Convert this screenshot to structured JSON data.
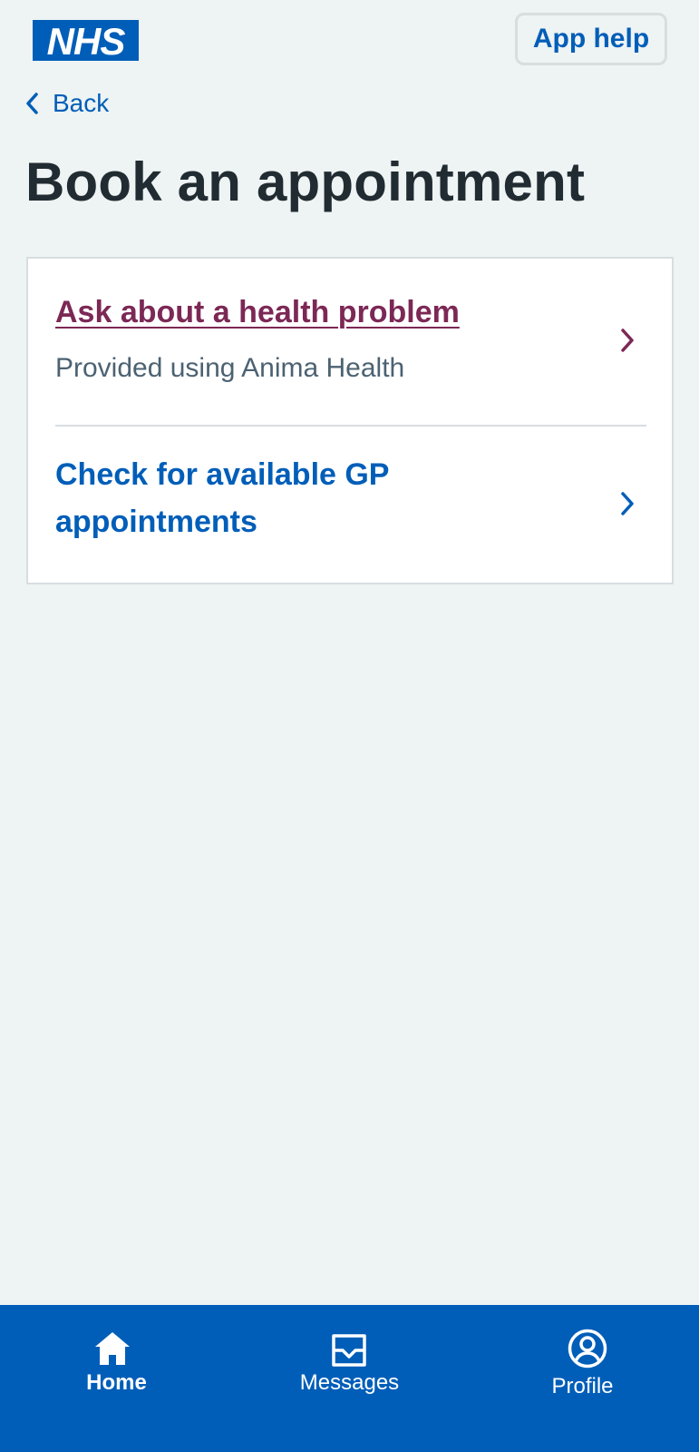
{
  "header": {
    "logo_text": "NHS",
    "app_help_label": "App help",
    "brand_color": "#005eb8"
  },
  "back": {
    "label": "Back"
  },
  "page": {
    "title": "Book an appointment"
  },
  "options": [
    {
      "title": "Ask about a health problem",
      "subtitle": "Provided using Anima Health",
      "icon": "chevron-right-icon",
      "color": "#7c2855"
    },
    {
      "title": "Check for available GP appointments",
      "icon": "chevron-right-icon",
      "color": "#005eb8"
    }
  ],
  "bottom_nav": {
    "items": [
      {
        "label": "Home",
        "icon": "home-icon",
        "active": true
      },
      {
        "label": "Messages",
        "icon": "messages-icon",
        "active": false
      },
      {
        "label": "Profile",
        "icon": "profile-icon",
        "active": false
      }
    ]
  }
}
